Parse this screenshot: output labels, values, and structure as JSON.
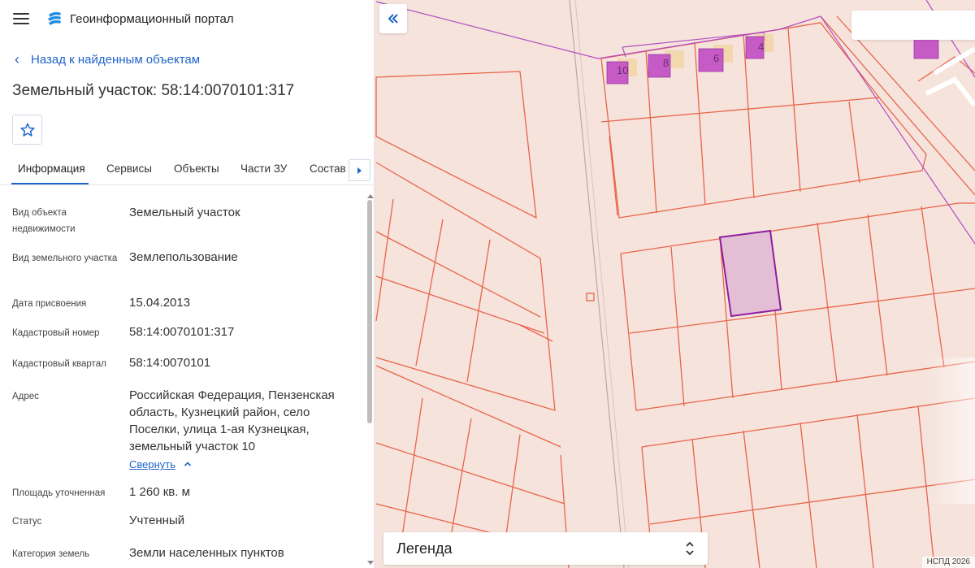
{
  "header": {
    "app_title": "Геоинформационный портал"
  },
  "nav": {
    "back_label": "Назад к найденным объектам"
  },
  "object": {
    "title": "Земельный участок: 58:14:0070101:317"
  },
  "tabs": [
    {
      "label": "Информация",
      "active": true
    },
    {
      "label": "Сервисы"
    },
    {
      "label": "Объекты"
    },
    {
      "label": "Части ЗУ"
    },
    {
      "label": "Состав"
    }
  ],
  "info": {
    "rows": [
      {
        "label": "Вид объекта недвижимости",
        "value": "Земельный участок"
      },
      {
        "label": "Вид земельного участка",
        "value": "Землепользование"
      },
      {
        "label": "Дата присвоения",
        "value": "15.04.2013"
      },
      {
        "label": "Кадастровый номер",
        "value": "58:14:0070101:317"
      },
      {
        "label": "Кадастровый квартал",
        "value": "58:14:0070101"
      },
      {
        "label": "Адрес",
        "value": "Российская Федерация, Пензенская область, Кузнецкий район, село Поселки, улица 1-ая Кузнецкая, земельный участок 10"
      },
      {
        "label": "Площадь уточненная",
        "value": "1 260 кв. м"
      },
      {
        "label": "Статус",
        "value": "Учтенный"
      },
      {
        "label": "Категория земель",
        "value": "Земли населенных пунктов"
      }
    ],
    "collapse_label": "Свернуть"
  },
  "map": {
    "building_labels": [
      "10",
      "8",
      "6",
      "4"
    ],
    "legend_title": "Легенда",
    "copyright": "НСПД 2026",
    "search_value": ""
  },
  "colors": {
    "accent": "#1f64c8",
    "map_background": "#f6e3dc",
    "parcel_line": "#e8654a",
    "selected_parcel_fill": "#e3bed4",
    "selected_parcel_stroke": "#8e1ea0",
    "building_fill": "#c65bc6"
  }
}
